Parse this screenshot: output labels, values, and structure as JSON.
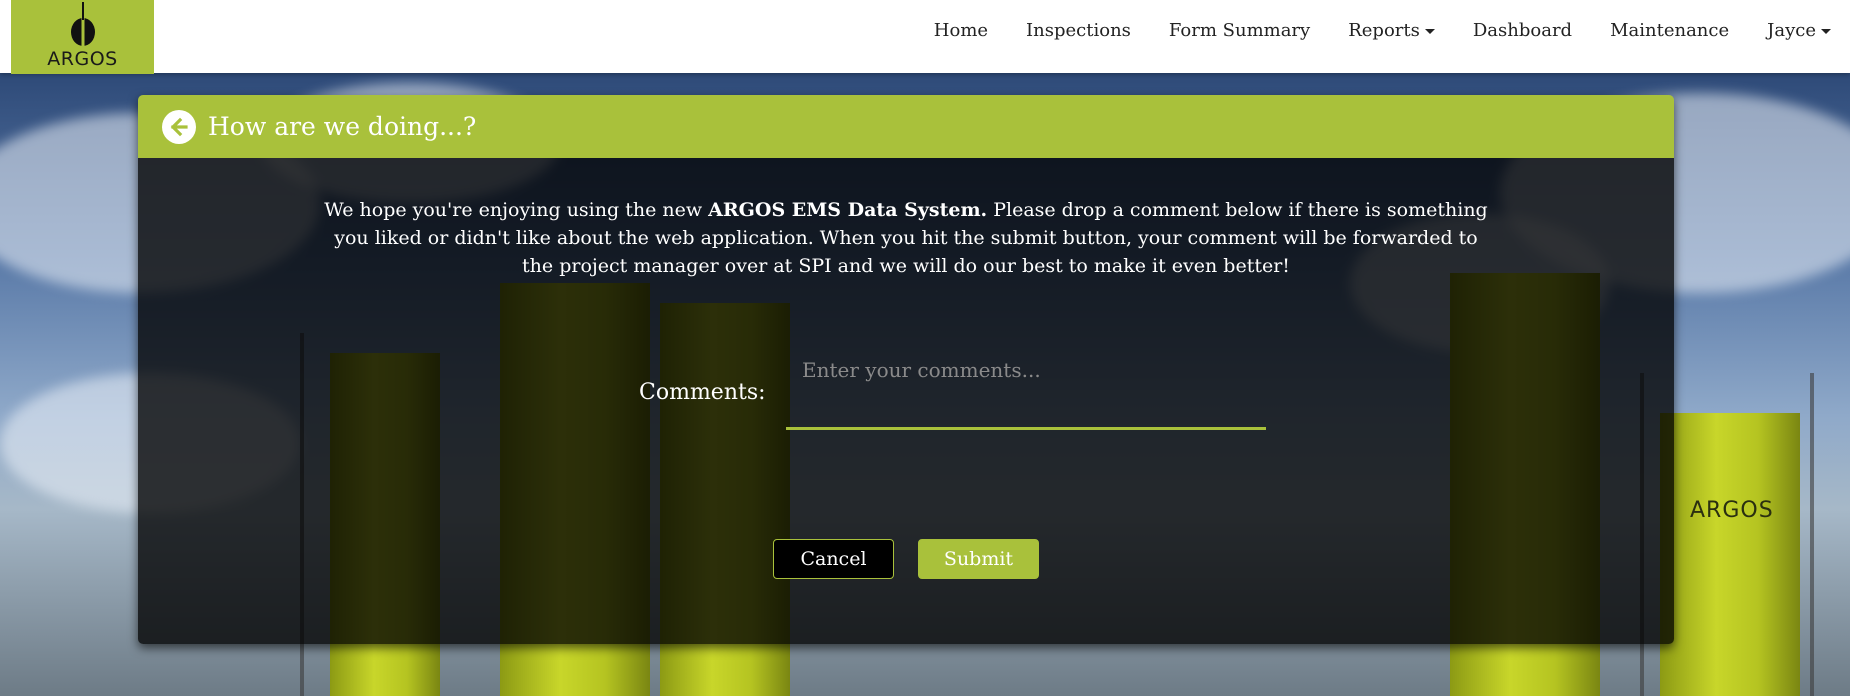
{
  "brand": {
    "logo_text": "ARGOS",
    "accent_color": "#a9c13b",
    "logo_icon": "argos-logo-icon"
  },
  "nav": {
    "items": [
      {
        "label": "Home",
        "dropdown": false
      },
      {
        "label": "Inspections",
        "dropdown": false
      },
      {
        "label": "Form Summary",
        "dropdown": false
      },
      {
        "label": "Reports",
        "dropdown": true
      },
      {
        "label": "Dashboard",
        "dropdown": false
      },
      {
        "label": "Maintenance",
        "dropdown": false
      },
      {
        "label": "Jayce",
        "dropdown": true
      }
    ]
  },
  "panel": {
    "title": "How are we doing...?",
    "back_icon": "arrow-left-circle-icon",
    "intro_before": "We hope you're enjoying using the new ",
    "intro_bold": "ARGOS EMS Data System.",
    "intro_after": " Please drop a comment below if there is something you liked or didn't like about the web application. When you hit the submit button, your comment will be forwarded to the project manager over at SPI and we will do our best to make it even better!",
    "comments_label": "Comments:",
    "comments_placeholder": "Enter your comments...",
    "comments_value": "",
    "cancel_label": "Cancel",
    "submit_label": "Submit"
  }
}
